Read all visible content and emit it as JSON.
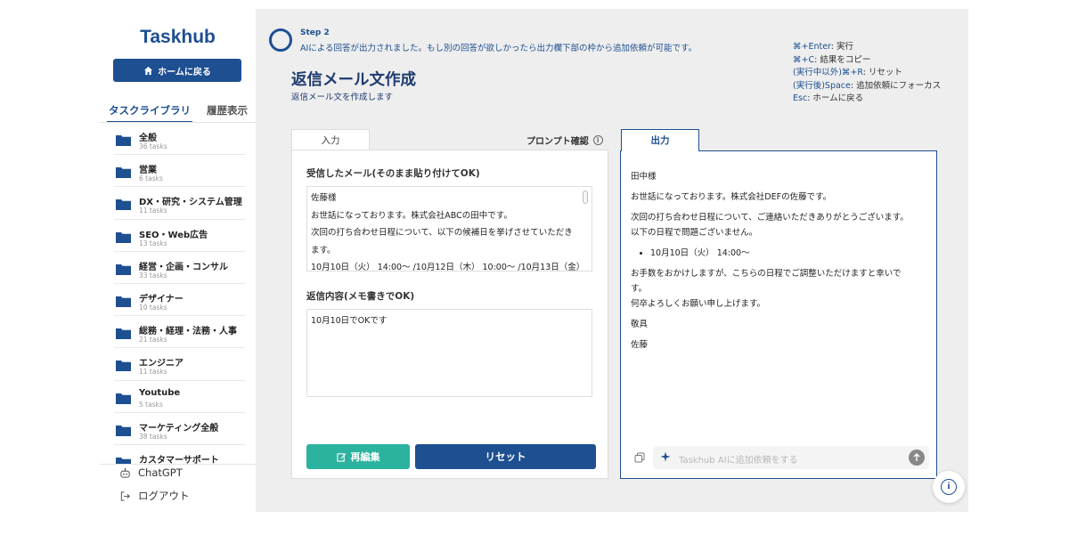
{
  "app": {
    "logo": "Taskhub",
    "home_button": "ホームに戻る"
  },
  "sidebar": {
    "tabs": [
      {
        "label": "タスクライブラリ",
        "active": true
      },
      {
        "label": "履歴表示",
        "active": false
      }
    ],
    "categories": [
      {
        "name": "全般",
        "count": "36 tasks"
      },
      {
        "name": "営業",
        "count": "6 tasks"
      },
      {
        "name": "DX・研究・システム管理",
        "count": "11 tasks"
      },
      {
        "name": "SEO・Web広告",
        "count": "13 tasks"
      },
      {
        "name": "経営・企画・コンサル",
        "count": "33 tasks"
      },
      {
        "name": "デザイナー",
        "count": "10 tasks"
      },
      {
        "name": "総務・経理・法務・人事",
        "count": "21 tasks"
      },
      {
        "name": "エンジニア",
        "count": "11 tasks"
      },
      {
        "name": "Youtube",
        "count": "5 tasks"
      },
      {
        "name": "マーケティング全般",
        "count": "38 tasks"
      },
      {
        "name": "カスタマーサポート",
        "count": ""
      }
    ],
    "chatgpt_label": "ChatGPT",
    "logout_label": "ログアウト"
  },
  "step": {
    "label": "Step 2",
    "description": "AIによる回答が出力されました。もし別の回答が欲しかったら出力欄下部の枠から追加依頼が可能です。"
  },
  "shortcuts": [
    {
      "key": "⌘+Enter",
      "desc": ": 実行"
    },
    {
      "key": "⌘+C",
      "desc": ": 結果をコピー"
    },
    {
      "key": "(実行中以外)⌘+R",
      "desc": ": リセット"
    },
    {
      "key": "(実行後)Space",
      "desc": ": 追加依頼にフォーカス"
    },
    {
      "key": "Esc",
      "desc": ": ホームに戻る"
    }
  ],
  "page": {
    "title": "返信メール文作成",
    "subtitle": "返信メール文を作成します"
  },
  "input_panel": {
    "tab_label": "入力",
    "prompt_link": "プロンプト確認",
    "field1_label": "受信したメール(そのまま貼り付けてOK)",
    "field1_lines": [
      "佐藤様",
      "お世話になっております。株式会社ABCの田中です。",
      "次回の打ち合わせ日程について、以下の候補日を挙げさせていただき",
      "ます。",
      "10月10日（火） 14:00〜 /10月12日（木） 10:00〜 /10月13日（金）"
    ],
    "field2_label": "返信内容(メモ書きでOK)",
    "field2_value": "10月10日でOKです",
    "reedit_button": "再編集",
    "reset_button": "リセット"
  },
  "output_panel": {
    "tab_label": "出力",
    "lines": {
      "greeting": "田中様",
      "intro": "お世話になっております。株式会社DEFの佐藤です。",
      "thanks": "次回の打ち合わせ日程について、ご連絡いただきありがとうございます。",
      "ok": "以下の日程で問題ございません。",
      "bullet": "10月10日（火） 14:00〜",
      "request1": "お手数をおかけしますが、こちらの日程でご調整いただけますと幸いで",
      "request2": "す。",
      "closing": "何卒よろしくお願い申し上げます。",
      "sign1": "敬具",
      "sign2": "佐藤"
    },
    "followup_placeholder": "Taskhub AIに追加依頼をする"
  },
  "colors": {
    "brand": "#1d4f91",
    "teal": "#2bb39f",
    "main_bg": "#eeeeee"
  }
}
